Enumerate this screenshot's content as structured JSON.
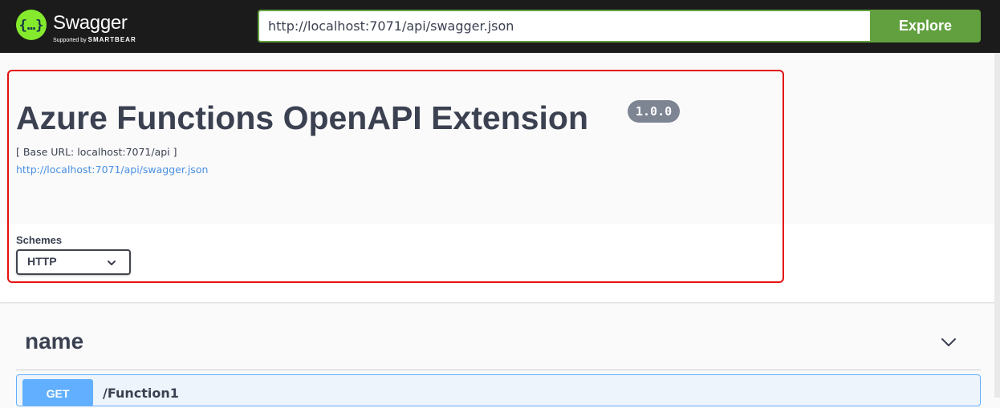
{
  "topbar": {
    "brand": "Swagger",
    "supported_by": "Supported by",
    "smartbear": "SMARTBEAR",
    "url_value": "http://localhost:7071/api/swagger.json",
    "explore_label": "Explore",
    "brand_color": "#85ea2d",
    "accent_color": "#62a03f"
  },
  "info": {
    "title": "Azure Functions OpenAPI Extension",
    "version": "1.0.0",
    "base_url": "[ Base URL: localhost:7071/api ]",
    "spec_link": "http://localhost:7071/api/swagger.json"
  },
  "schemes": {
    "label": "Schemes",
    "selected": "HTTP"
  },
  "tag": {
    "name": "name"
  },
  "operation": {
    "method": "GET",
    "path": "/Function1",
    "method_color": "#61affe"
  },
  "highlight_color": "#e51010"
}
